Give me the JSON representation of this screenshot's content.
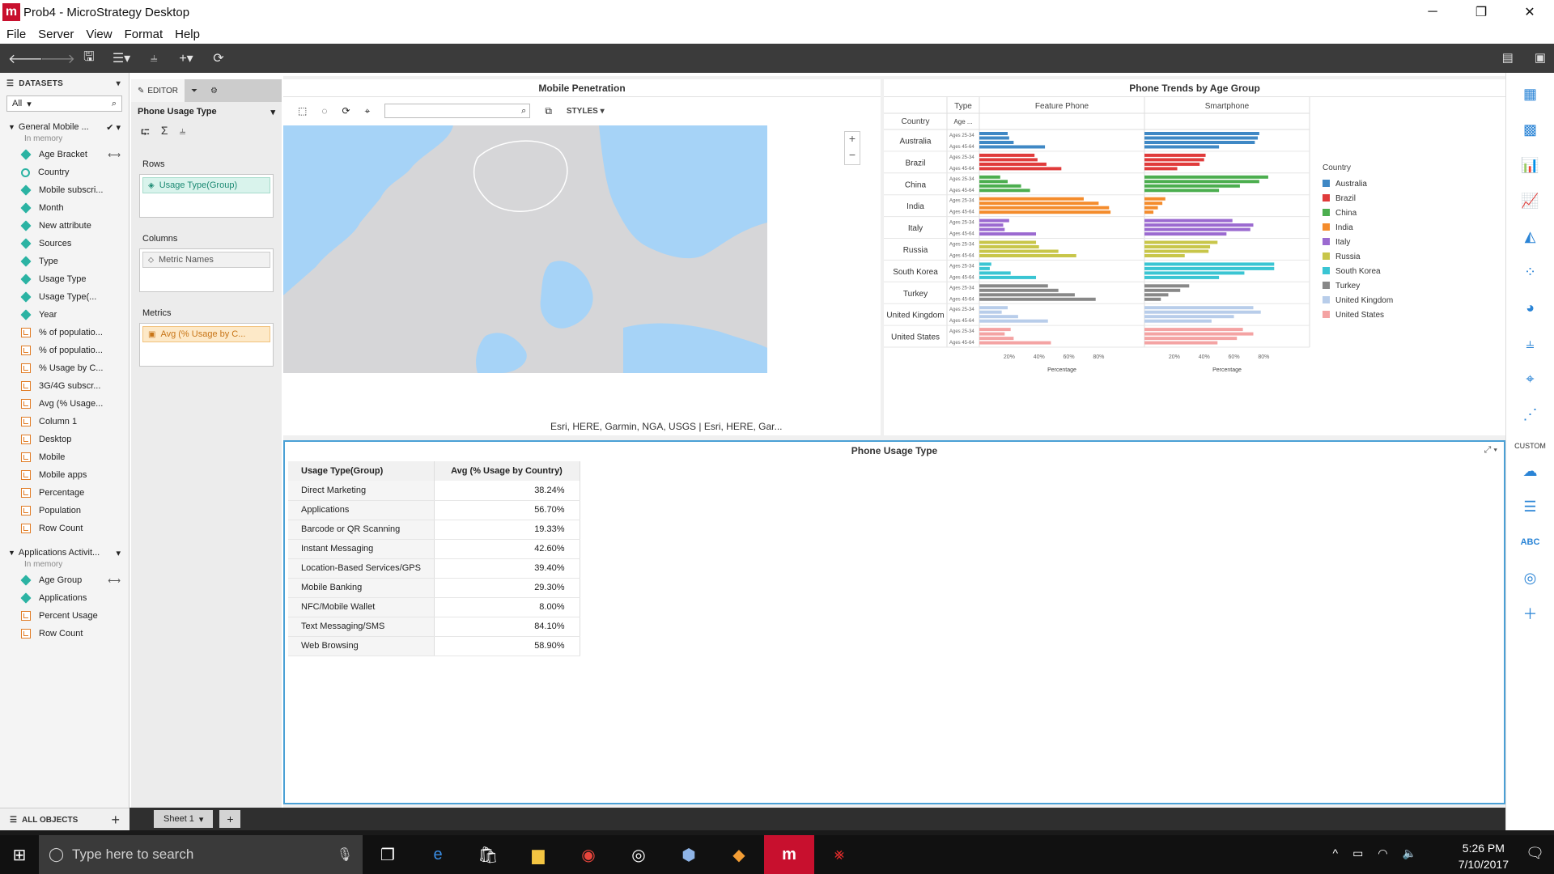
{
  "window": {
    "title": "Prob4 - MicroStrategy Desktop",
    "logo": "m"
  },
  "menu": [
    "File",
    "Server",
    "View",
    "Format",
    "Help"
  ],
  "datasets": {
    "header": "DATASETS",
    "filter": "All",
    "groups": [
      {
        "name": "General Mobile ...",
        "status": "In memory",
        "objects": [
          {
            "label": "Age Bracket",
            "kind": "attribute",
            "linked": true
          },
          {
            "label": "Country",
            "kind": "geo"
          },
          {
            "label": "Mobile subscri...",
            "kind": "attribute"
          },
          {
            "label": "Month",
            "kind": "attribute"
          },
          {
            "label": "New attribute",
            "kind": "attribute"
          },
          {
            "label": "Sources",
            "kind": "attribute"
          },
          {
            "label": "Type",
            "kind": "attribute"
          },
          {
            "label": "Usage Type",
            "kind": "attribute"
          },
          {
            "label": "Usage Type(...",
            "kind": "attribute"
          },
          {
            "label": "Year",
            "kind": "attribute"
          },
          {
            "label": "% of populatio...",
            "kind": "metric"
          },
          {
            "label": "% of populatio...",
            "kind": "metric"
          },
          {
            "label": "% Usage by C...",
            "kind": "metric"
          },
          {
            "label": "3G/4G subscr...",
            "kind": "metric"
          },
          {
            "label": "Avg (% Usage...",
            "kind": "metric"
          },
          {
            "label": "Column 1",
            "kind": "metric"
          },
          {
            "label": "Desktop",
            "kind": "metric"
          },
          {
            "label": "Mobile",
            "kind": "metric"
          },
          {
            "label": "Mobile apps",
            "kind": "metric"
          },
          {
            "label": "Percentage",
            "kind": "metric"
          },
          {
            "label": "Population",
            "kind": "metric"
          },
          {
            "label": "Row Count",
            "kind": "metric"
          }
        ]
      },
      {
        "name": "Applications Activit...",
        "status": "In memory",
        "objects": [
          {
            "label": "Age Group",
            "kind": "attribute",
            "linked": true
          },
          {
            "label": "Applications",
            "kind": "attribute"
          },
          {
            "label": "Percent Usage",
            "kind": "metric"
          },
          {
            "label": "Row Count",
            "kind": "metric"
          }
        ]
      }
    ],
    "footer": "ALL OBJECTS"
  },
  "editor": {
    "tab_editor": "EDITOR",
    "viz_name": "Phone Usage Type",
    "rows_label": "Rows",
    "rows_item": "Usage Type(Group)",
    "columns_label": "Columns",
    "columns_item": "Metric Names",
    "metrics_label": "Metrics",
    "metrics_item": "Avg (% Usage by C..."
  },
  "sheet": {
    "name": "Sheet 1"
  },
  "map": {
    "title": "Mobile Penetration",
    "styles_label": "STYLES",
    "attribution": "Esri, HERE, Garmin, NGA, USGS | Esri, HERE, Gar..."
  },
  "trend": {
    "title": "Phone Trends by Age Group",
    "col_type": "Type",
    "col_country": "Country",
    "col_age": "Age ...",
    "type_a": "Feature Phone",
    "type_b": "Smartphone",
    "axis_label": "Percentage",
    "legend_title": "Country",
    "age_labels": [
      "Ages 25-34",
      "Ages 45-64"
    ]
  },
  "usage": {
    "title": "Phone Usage Type",
    "col_attr": "Usage Type(Group)",
    "col_metric": "Avg (% Usage by Country)",
    "rows": [
      {
        "type": "Direct Marketing",
        "value": "38.24%"
      },
      {
        "type": "Applications",
        "value": "56.70%"
      },
      {
        "type": "Barcode or QR Scanning",
        "value": "19.33%"
      },
      {
        "type": "Instant Messaging",
        "value": "42.60%"
      },
      {
        "type": "Location-Based Services/GPS",
        "value": "39.40%"
      },
      {
        "type": "Mobile Banking",
        "value": "29.30%"
      },
      {
        "type": "NFC/Mobile Wallet",
        "value": "8.00%"
      },
      {
        "type": "Text Messaging/SMS",
        "value": "84.10%"
      },
      {
        "type": "Web Browsing",
        "value": "58.90%"
      }
    ]
  },
  "chart_data": {
    "type": "bar",
    "title": "Phone Trends by Age Group",
    "xlabel": "Percentage",
    "xticks": [
      "20%",
      "40%",
      "60%",
      "80%"
    ],
    "xlim": [
      0,
      100
    ],
    "panels": [
      "Feature Phone",
      "Smartphone"
    ],
    "bars_per_country": 4,
    "legend_position": "right",
    "categories": [
      "Australia",
      "Brazil",
      "China",
      "India",
      "Italy",
      "Russia",
      "South Korea",
      "Turkey",
      "United Kingdom",
      "United States"
    ],
    "colors": [
      "#3f88c5",
      "#e03b3b",
      "#4cae4f",
      "#f48c2c",
      "#9b6ad0",
      "#c8c64a",
      "#3ac5d3",
      "#888888",
      "#b8cdea",
      "#f4a3a3"
    ],
    "series": [
      {
        "name": "Australia",
        "feature_phone": [
          19,
          20,
          23,
          44
        ],
        "smartphone": [
          77,
          76,
          74,
          50
        ]
      },
      {
        "name": "Brazil",
        "feature_phone": [
          37,
          39,
          45,
          55
        ],
        "smartphone": [
          41,
          40,
          37,
          22
        ]
      },
      {
        "name": "China",
        "feature_phone": [
          14,
          19,
          28,
          34
        ],
        "smartphone": [
          83,
          77,
          64,
          50
        ]
      },
      {
        "name": "India",
        "feature_phone": [
          70,
          80,
          87,
          88
        ],
        "smartphone": [
          14,
          12,
          9,
          6
        ]
      },
      {
        "name": "Italy",
        "feature_phone": [
          20,
          16,
          17,
          38
        ],
        "smartphone": [
          59,
          73,
          71,
          55
        ]
      },
      {
        "name": "Russia",
        "feature_phone": [
          38,
          40,
          53,
          65
        ],
        "smartphone": [
          49,
          44,
          43,
          27
        ]
      },
      {
        "name": "South Korea",
        "feature_phone": [
          8,
          7,
          21,
          38
        ],
        "smartphone": [
          87,
          87,
          67,
          50
        ]
      },
      {
        "name": "Turkey",
        "feature_phone": [
          46,
          53,
          64,
          78
        ],
        "smartphone": [
          30,
          24,
          16,
          11
        ]
      },
      {
        "name": "United Kingdom",
        "feature_phone": [
          19,
          15,
          26,
          46
        ],
        "smartphone": [
          73,
          78,
          60,
          45
        ]
      },
      {
        "name": "United States",
        "feature_phone": [
          21,
          17,
          23,
          48
        ],
        "smartphone": [
          66,
          73,
          62,
          49
        ]
      }
    ]
  }
}
